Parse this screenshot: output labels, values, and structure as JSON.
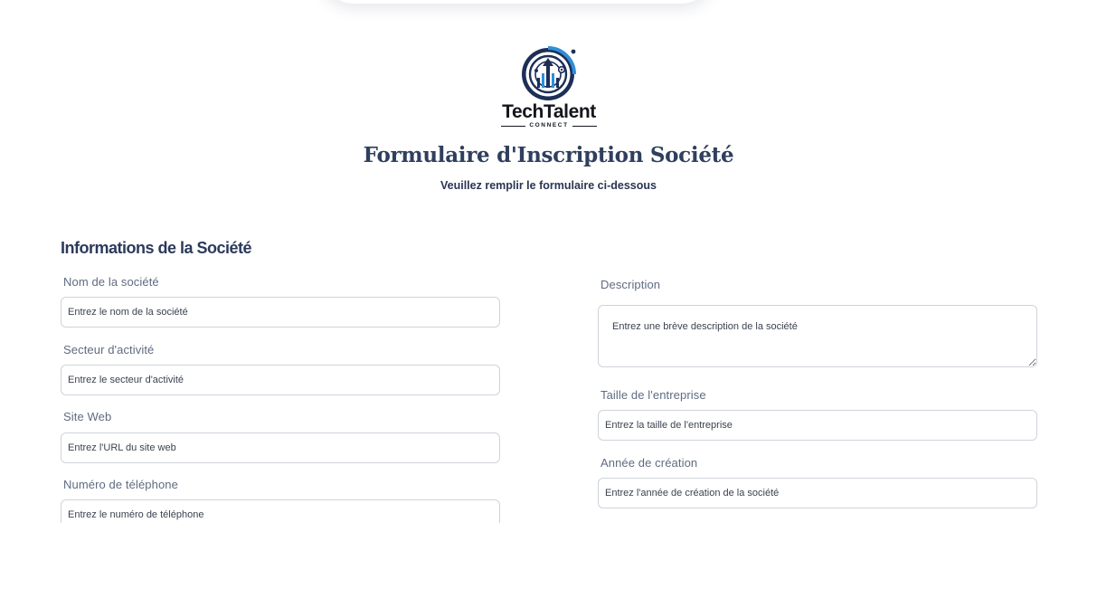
{
  "logo": {
    "icon": "techtalent-logo-icon",
    "brand_name": "TechTalent",
    "brand_tagline": "CONNECT",
    "registered_mark": "®"
  },
  "header": {
    "title": "Formulaire d'Inscription Société",
    "subtitle": "Veuillez remplir le formulaire ci-dessous"
  },
  "section": {
    "title": "Informations de la Société"
  },
  "fields_left": [
    {
      "label": "Nom de la société",
      "placeholder": "Entrez le nom de la société"
    },
    {
      "label": "Secteur d'activité",
      "placeholder": "Entrez le secteur d'activité"
    },
    {
      "label": "Site Web",
      "placeholder": "Entrez l'URL du site web"
    },
    {
      "label": "Numéro de téléphone",
      "placeholder": "Entrez le numéro de téléphone"
    }
  ],
  "fields_right": [
    {
      "label": "Description",
      "placeholder": "Entrez une brève description de la société"
    },
    {
      "label": "Taille de l'entreprise",
      "placeholder": "Entrez la taille de l'entreprise"
    },
    {
      "label": "Année de création",
      "placeholder": "Entrez l'année de création de la société"
    }
  ],
  "colors": {
    "title": "#2f3f5e",
    "label": "#5f6b80",
    "input_border": "#cfd3da",
    "logo_ring": "#1c2f57",
    "logo_accent": "#2f8fd8"
  }
}
